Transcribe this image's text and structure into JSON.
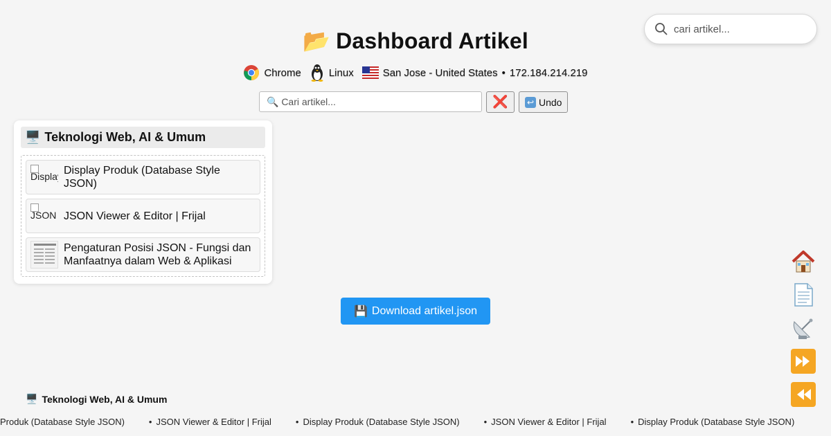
{
  "top_search": {
    "placeholder": "cari artikel..."
  },
  "header": {
    "title_emoji": "📂",
    "title": "Dashboard Artikel"
  },
  "sysinfo": {
    "browser": "Chrome",
    "os": "Linux",
    "location": "San Jose - United States",
    "separator": "•",
    "ip": "172.184.214.219"
  },
  "controls": {
    "search_placeholder": "🔍 Cari artikel...",
    "clear_label": "❌",
    "undo_label": "Undo"
  },
  "category": {
    "icon": "🖥️",
    "title": "Teknologi Web, AI & Umum",
    "items": [
      {
        "thumb_alt": "Display Produk",
        "thumb_type": "broken",
        "title": "Display Produk (Database Style JSON)"
      },
      {
        "thumb_alt": "JSON Viewer",
        "thumb_type": "broken",
        "title": "JSON Viewer & Editor | Frijal"
      },
      {
        "thumb_alt": "",
        "thumb_type": "image",
        "title": "Pengaturan Posisi JSON - Fungsi dan Manfaatnya dalam Web & Aplikasi"
      }
    ]
  },
  "download": {
    "icon": "💾",
    "label": "Download artikel.json"
  },
  "side_nav": [
    "home-icon",
    "document-icon",
    "satellite-icon",
    "fast-forward-icon",
    "rewind-icon"
  ],
  "footer": {
    "category_icon": "🖥️",
    "category_title": "Teknologi Web, AI & Umum",
    "ticker": [
      "Produk (Database Style JSON)",
      "JSON Viewer & Editor | Frijal",
      "Display Produk (Database Style JSON)",
      "JSON Viewer & Editor | Frijal",
      "Display Produk (Database Style JSON)"
    ]
  },
  "colors": {
    "accent": "#2196f3",
    "background": "#f5f5f5",
    "clear": "#e02424"
  }
}
